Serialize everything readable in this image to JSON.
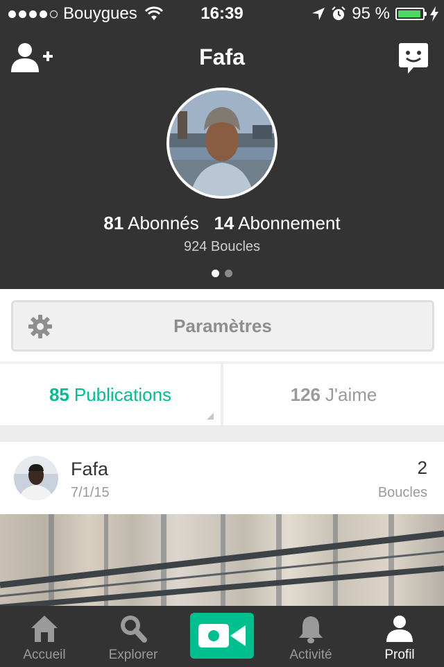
{
  "status_bar": {
    "carrier": "Bouygues",
    "time": "16:39",
    "battery_text": "95 %",
    "battery_level": 0.95
  },
  "profile": {
    "name": "Fafa",
    "followers_count": "81",
    "followers_label": "Abonnés",
    "following_count": "14",
    "following_label": "Abonnement",
    "loops_text": "924 Boucles",
    "pager_pages": 2,
    "pager_active": 0
  },
  "settings": {
    "label": "Paramètres"
  },
  "tabs": [
    {
      "count": "85",
      "label": "Publications",
      "active": true
    },
    {
      "count": "126",
      "label": "J'aime",
      "active": false
    }
  ],
  "post": {
    "author": "Fafa",
    "date": "7/1/15",
    "loops_count": "2",
    "loops_label": "Boucles"
  },
  "tabbar": {
    "items": [
      {
        "label": "Accueil",
        "icon": "home-icon"
      },
      {
        "label": "Explorer",
        "icon": "search-icon"
      },
      {
        "label": "",
        "icon": "video-camera-icon"
      },
      {
        "label": "Activité",
        "icon": "bell-icon"
      },
      {
        "label": "Profil",
        "icon": "profile-icon"
      }
    ],
    "active": "Profil"
  },
  "colors": {
    "header_bg": "#333333",
    "accent_green": "#00bf8f",
    "battery_green": "#4cd964"
  }
}
